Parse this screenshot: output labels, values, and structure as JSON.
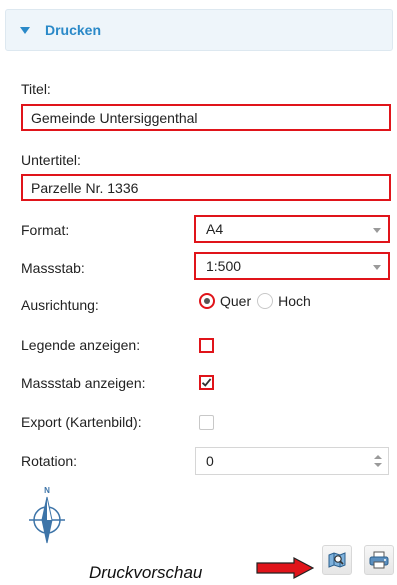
{
  "panel": {
    "title": "Drucken"
  },
  "fields": {
    "titel_label": "Titel:",
    "titel_value": "Gemeinde Untersiggenthal",
    "untertitel_label": "Untertitel:",
    "untertitel_value": "Parzelle Nr. 1336",
    "format_label": "Format:",
    "format_value": "A4",
    "massstab_label": "Massstab:",
    "massstab_value": "1:500",
    "ausrichtung_label": "Ausrichtung:",
    "ausrichtung_options": [
      "Quer",
      "Hoch"
    ],
    "ausrichtung_selected": "Quer",
    "legende_label": "Legende anzeigen:",
    "legende_checked": false,
    "massstab_anzeigen_label": "Massstab anzeigen:",
    "massstab_anzeigen_checked": true,
    "export_label": "Export (Kartenbild):",
    "export_checked": false,
    "rotation_label": "Rotation:",
    "rotation_value": "0"
  },
  "north_arrow": {
    "label": "N"
  },
  "preview": {
    "label": "Druckvorschau"
  },
  "icons": {
    "panel_toggle": "caret-down-icon",
    "preview_button": "map-preview-icon",
    "print_button": "printer-icon",
    "north_arrow": "north-arrow-icon"
  },
  "colors": {
    "accent": "#2a89c8",
    "highlight": "#e0141a",
    "header_bg": "#eef5fa",
    "north_arrow": "#3d74a8"
  }
}
